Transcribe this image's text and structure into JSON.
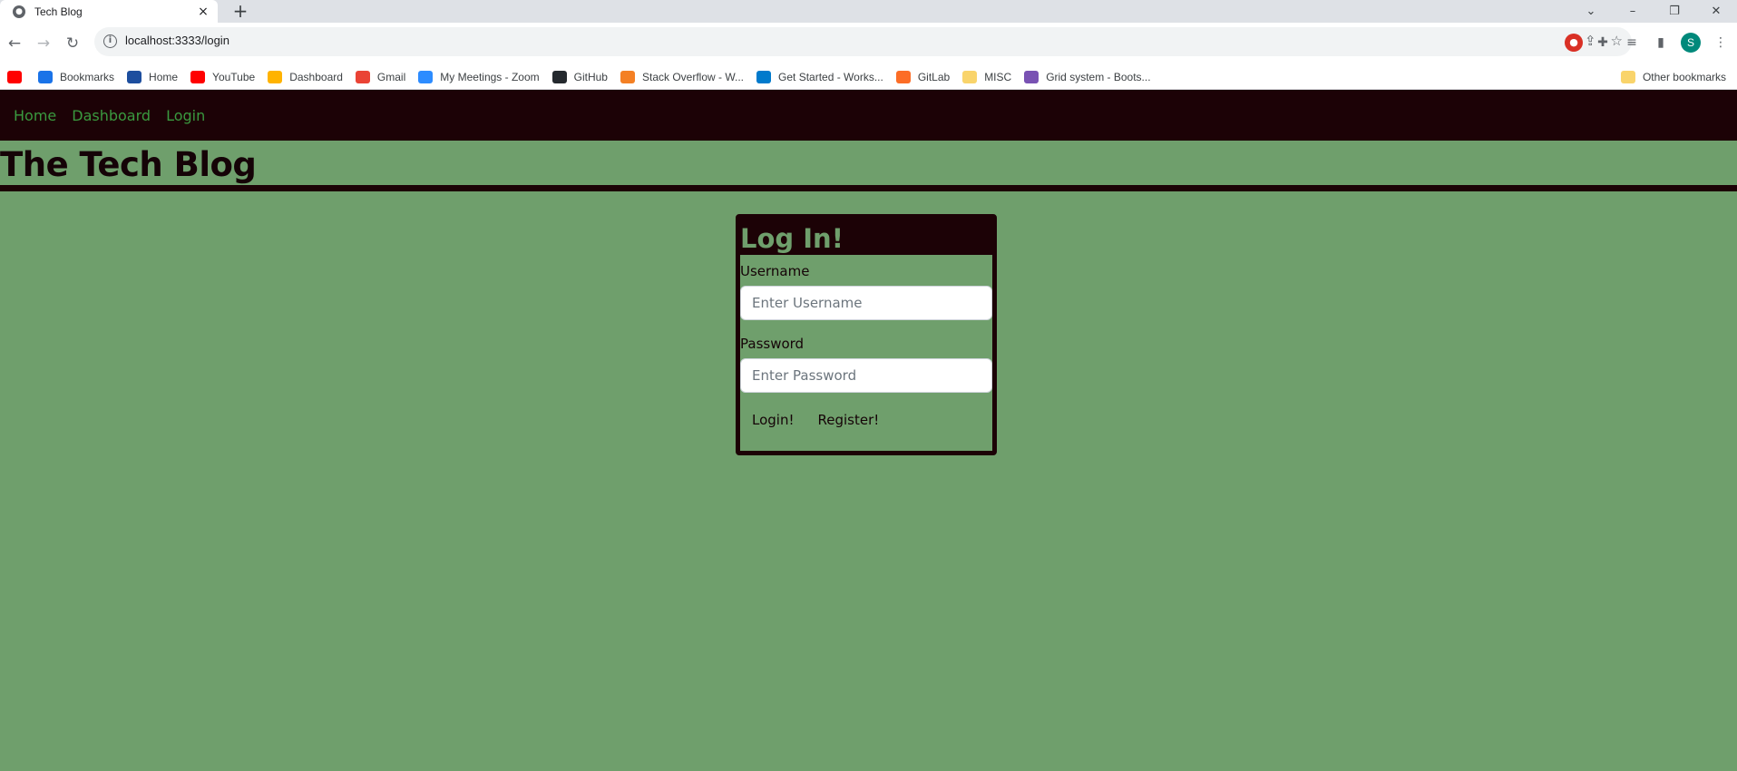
{
  "browser": {
    "tab_title": "Tech Blog",
    "tab_close": "×",
    "new_tab": "+",
    "url": "localhost:3333/login",
    "profile_initial": "S",
    "bookmarks": [
      {
        "label": "",
        "icon": "youtube-icon",
        "color": "#ff0000"
      },
      {
        "label": "Bookmarks",
        "icon": "star-icon",
        "color": "#1a73e8"
      },
      {
        "label": "Home",
        "icon": "s-logo-icon",
        "color": "#1d4e9e"
      },
      {
        "label": "YouTube",
        "icon": "youtube-icon",
        "color": "#ff0000"
      },
      {
        "label": "Dashboard",
        "icon": "dashboard-icon",
        "color": "#ffb300"
      },
      {
        "label": "Gmail",
        "icon": "gmail-icon",
        "color": "#ea4335"
      },
      {
        "label": "My Meetings - Zoom",
        "icon": "zoom-icon",
        "color": "#2d8cff"
      },
      {
        "label": "GitHub",
        "icon": "github-icon",
        "color": "#24292e"
      },
      {
        "label": "Stack Overflow - W...",
        "icon": "stackoverflow-icon",
        "color": "#f48024"
      },
      {
        "label": "Get Started - Works...",
        "icon": "vscode-icon",
        "color": "#007acc"
      },
      {
        "label": "GitLab",
        "icon": "gitlab-icon",
        "color": "#fc6d26"
      },
      {
        "label": "MISC",
        "icon": "folder-icon",
        "color": "#f9d46b"
      },
      {
        "label": "Grid system - Boots...",
        "icon": "bootstrap-icon",
        "color": "#7952b3"
      }
    ],
    "other_bookmarks": "Other bookmarks"
  },
  "nav": {
    "home": "Home",
    "dashboard": "Dashboard",
    "login": "Login"
  },
  "site_title": "The Tech Blog",
  "login": {
    "heading": "Log In!",
    "username_label": "Username",
    "username_placeholder": "Enter Username",
    "password_label": "Password",
    "password_placeholder": "Enter Password",
    "login_button": "Login!",
    "register_button": "Register!"
  },
  "colors": {
    "page_bg": "#6f9f6c",
    "nav_bg": "#1c0206",
    "nav_link": "#3a9a3f"
  }
}
